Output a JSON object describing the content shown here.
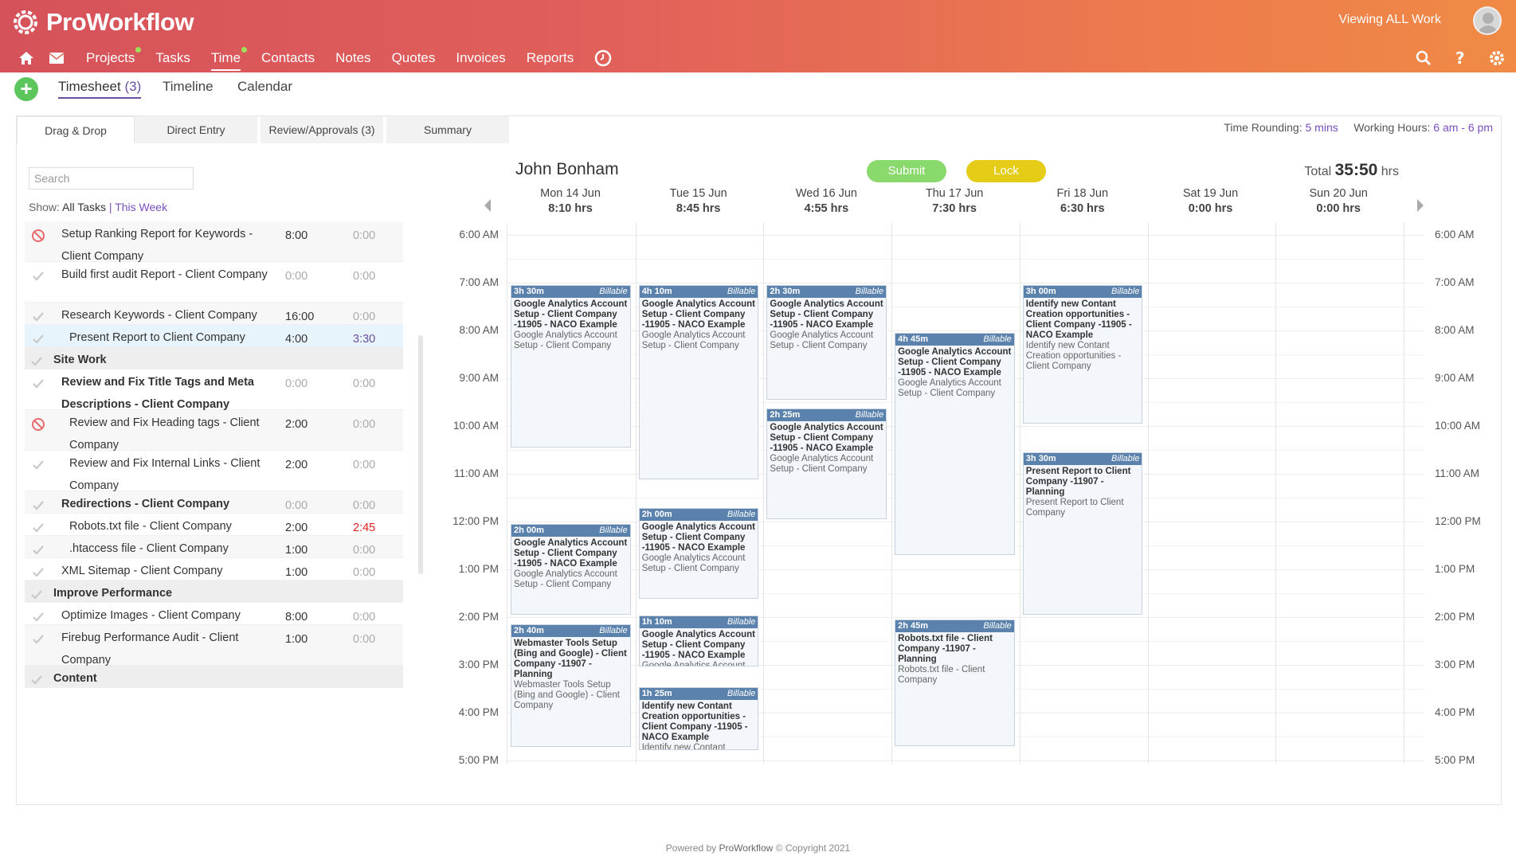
{
  "app": {
    "name": "ProWorkflow",
    "viewing": "Viewing ALL Work"
  },
  "nav": {
    "items": [
      {
        "label": "Projects",
        "dot": true
      },
      {
        "label": "Tasks",
        "dot": false
      },
      {
        "label": "Time",
        "dot": true,
        "active": true
      },
      {
        "label": "Contacts",
        "dot": false
      },
      {
        "label": "Notes",
        "dot": false
      },
      {
        "label": "Quotes",
        "dot": false
      },
      {
        "label": "Invoices",
        "dot": false
      },
      {
        "label": "Reports",
        "dot": false
      }
    ]
  },
  "subnav": {
    "tabs": [
      "Timesheet",
      "(3)",
      "Timeline",
      "Calendar"
    ],
    "add_label": "+"
  },
  "inner_tabs": [
    "Drag & Drop",
    "Direct Entry",
    "Review/Approvals (3)",
    "Summary"
  ],
  "rounding": {
    "label": "Time Rounding:",
    "value": "5 mins",
    "hours_label": "Working Hours:",
    "hours_value": "6 am - 6 pm"
  },
  "left": {
    "search_placeholder": "Search",
    "show_label": "Show:",
    "show_current": "All Tasks",
    "show_sep": "|",
    "show_link": "This Week"
  },
  "tasks": [
    {
      "name": "Setup Ranking Report for Keywords - Client Company",
      "est": "8:00",
      "act": "0:00",
      "icon": "blocked"
    },
    {
      "name": "Build first audit Report - Client Company",
      "est": "0:00",
      "act": "0:00",
      "icon": "check"
    },
    {
      "name": "Research Keywords - Client Company",
      "est": "16:00",
      "act": "0:00",
      "icon": "check"
    },
    {
      "name": "Present Report to Client Company",
      "est": "4:00",
      "act": "3:30",
      "icon": "check"
    },
    {
      "name": "Site Work",
      "icon": "check"
    },
    {
      "name": "Review and Fix Title Tags and Meta Descriptions - Client Company",
      "est": "0:00",
      "act": "0:00",
      "icon": "check"
    },
    {
      "name": "Review and Fix Heading tags - Client Company",
      "est": "2:00",
      "act": "0:00",
      "icon": "blocked"
    },
    {
      "name": "Review and Fix Internal Links - Client Company",
      "est": "2:00",
      "act": "0:00",
      "icon": "check"
    },
    {
      "name": "Redirections - Client Company",
      "est": "0:00",
      "act": "0:00",
      "icon": "check"
    },
    {
      "name": "Robots.txt file - Client Company",
      "est": "2:00",
      "act": "2:45",
      "icon": "check"
    },
    {
      "name": ".htaccess file - Client Company",
      "est": "1:00",
      "act": "0:00",
      "icon": "check"
    },
    {
      "name": "XML Sitemap - Client Company",
      "est": "1:00",
      "act": "0:00",
      "icon": "check"
    },
    {
      "name": "Improve Performance",
      "icon": "check"
    },
    {
      "name": "Optimize Images - Client Company",
      "est": "8:00",
      "act": "0:00",
      "icon": "check"
    },
    {
      "name": "Firebug Performance Audit - Client Company",
      "est": "1:00",
      "act": "0:00",
      "icon": "check"
    },
    {
      "name": "Content",
      "icon": "check"
    }
  ],
  "calendar": {
    "person": "John Bonham",
    "submit": "Submit",
    "lock": "Lock",
    "total_label": "Total",
    "total_value": "35:50",
    "total_unit": "hrs",
    "days": [
      {
        "label": "Mon 14 Jun",
        "hrs": "8:10 hrs"
      },
      {
        "label": "Tue 15 Jun",
        "hrs": "8:45 hrs"
      },
      {
        "label": "Wed 16 Jun",
        "hrs": "4:55 hrs"
      },
      {
        "label": "Thu 17 Jun",
        "hrs": "7:30 hrs"
      },
      {
        "label": "Fri 18 Jun",
        "hrs": "6:30 hrs"
      },
      {
        "label": "Sat 19 Jun",
        "hrs": "0:00 hrs"
      },
      {
        "label": "Sun 20 Jun",
        "hrs": "0:00 hrs"
      }
    ],
    "times": [
      "6:00 AM",
      "7:00 AM",
      "8:00 AM",
      "9:00 AM",
      "10:00 AM",
      "11:00 AM",
      "12:00 PM",
      "1:00 PM",
      "2:00 PM",
      "3:00 PM",
      "4:00 PM",
      "5:00 PM"
    ],
    "billable": "Billable",
    "entries": [
      {
        "day": 0,
        "start": 7.0,
        "dur": 3.5,
        "dur_label": "3h 30m",
        "title": "Google Analytics Account Setup - Client Company -11905 - NACO Example",
        "desc": "Google Analytics Account Setup - Client Company"
      },
      {
        "day": 0,
        "start": 12.0,
        "dur": 2.0,
        "dur_label": "2h 00m",
        "title": "Google Analytics Account Setup - Client Company -11905 - NACO Example",
        "desc": "Google Analytics Account Setup - Client Company"
      },
      {
        "day": 0,
        "start": 14.1,
        "dur": 2.67,
        "dur_label": "2h 40m",
        "title": "Webmaster Tools Setup (Bing and Google) - Client Company -11907 - Planning",
        "desc": "Webmaster Tools Setup (Bing and Google) - Client Company"
      },
      {
        "day": 1,
        "start": 7.0,
        "dur": 4.17,
        "dur_label": "4h 10m",
        "title": "Google Analytics Account Setup - Client Company -11905 - NACO Example",
        "desc": "Google Analytics Account Setup - Client Company"
      },
      {
        "day": 1,
        "start": 11.67,
        "dur": 2.0,
        "dur_label": "2h 00m",
        "title": "Google Analytics Account Setup - Client Company -11905 - NACO Example",
        "desc": "Google Analytics Account Setup - Client Company"
      },
      {
        "day": 1,
        "start": 13.92,
        "dur": 1.17,
        "dur_label": "1h 10m",
        "title": "Google Analytics Account Setup - Client Company -11905 - NACO Example",
        "desc": "Google Analytics Account"
      },
      {
        "day": 1,
        "start": 15.42,
        "dur": 1.42,
        "dur_label": "1h 25m",
        "title": "Identify new Contant Creation opportunities - Client Company -11905 - NACO Example",
        "desc": "Identify new Contant"
      },
      {
        "day": 2,
        "start": 7.0,
        "dur": 2.5,
        "dur_label": "2h 30m",
        "title": "Google Analytics Account Setup - Client Company -11905 - NACO Example",
        "desc": "Google Analytics Account Setup - Client Company"
      },
      {
        "day": 2,
        "start": 9.58,
        "dur": 2.42,
        "dur_label": "2h 25m",
        "title": "Google Analytics Account Setup - Client Company -11905 - NACO Example",
        "desc": "Google Analytics Account Setup - Client Company"
      },
      {
        "day": 3,
        "start": 8.0,
        "dur": 4.75,
        "dur_label": "4h 45m",
        "title": "Google Analytics Account Setup - Client Company -11905 - NACO Example",
        "desc": "Google Analytics Account Setup - Client Company"
      },
      {
        "day": 3,
        "start": 14.0,
        "dur": 2.75,
        "dur_label": "2h 45m",
        "title": "Robots.txt file - Client Company -11907 - Planning",
        "desc": "Robots.txt file - Client Company"
      },
      {
        "day": 4,
        "start": 7.0,
        "dur": 3.0,
        "dur_label": "3h 00m",
        "title": "Identify new Contant Creation opportunities - Client Company -11905 - NACO Example",
        "desc": "Identify new Contant Creation opportunities - Client Company"
      },
      {
        "day": 4,
        "start": 10.5,
        "dur": 3.5,
        "dur_label": "3h 30m",
        "title": "Present Report to Client Company -11907 - Planning",
        "desc": "Present Report to Client Company"
      }
    ]
  },
  "footer": {
    "text": "Powered by",
    "link": "ProWorkflow",
    "copyright": "© Copyright 2021"
  },
  "colors": {
    "header_start": "#d5525a",
    "header_end": "#f08a45",
    "accent": "#7a4fc0",
    "entry_bar": "#5b82ad",
    "submit": "#8ad96c",
    "lock": "#e5cc16"
  }
}
